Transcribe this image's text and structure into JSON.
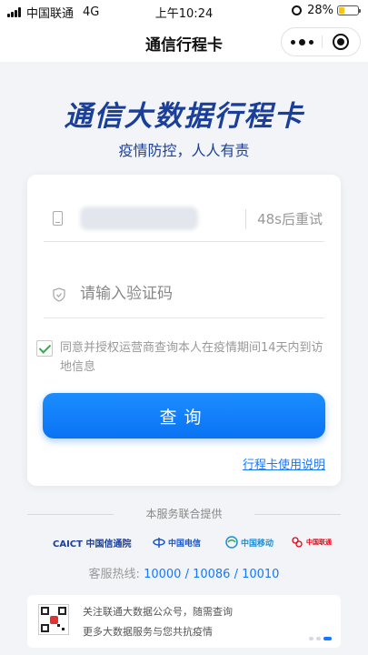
{
  "status_bar": {
    "carrier": "中国联通",
    "network": "4G",
    "time": "上午10:24",
    "battery": "28%",
    "battery_level": 0.28
  },
  "nav": {
    "title": "通信行程卡",
    "more_icon": "more-dots-icon",
    "close_icon": "target-close-icon"
  },
  "header": {
    "title": "通信大数据行程卡",
    "subtitle": "疫情防控，人人有责"
  },
  "form": {
    "phone_icon": "phone-icon",
    "retry_label": "48s后重试",
    "code_icon": "shield-icon",
    "code_placeholder": "请输入验证码",
    "code_value": "",
    "agree_checked": true,
    "agree_text": "同意并授权运营商查询本人在疫情期间14天内到访地信息",
    "query_label": "查询",
    "guide_link": "行程卡使用说明"
  },
  "providers": {
    "label": "本服务联合提供",
    "logos": [
      "CAICT 中国信通院",
      "中国电信",
      "中国移动",
      "中国联通"
    ]
  },
  "hotline": {
    "label": "客服热线:",
    "numbers": "10000 / 10086 / 10010"
  },
  "banner": {
    "line1": "关注联通大数据公众号，随需查询",
    "line2": "更多大数据服务与您共抗疫情",
    "qr_icon": "qr-code-icon"
  },
  "colors": {
    "brand_blue": "#1a3f9a",
    "button_blue": "#0a73f4",
    "link_blue": "#1677ff",
    "check_green": "#2fae4e"
  }
}
